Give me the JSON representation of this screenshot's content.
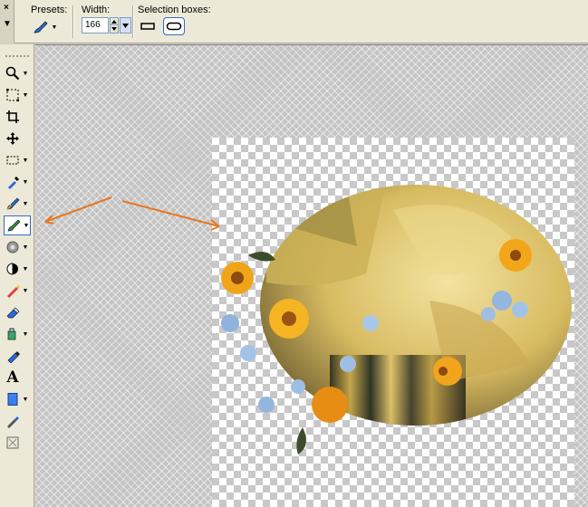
{
  "tool_options": {
    "presets_label": "Presets:",
    "width_label": "Width:",
    "width_value": "166",
    "selection_boxes_label": "Selection boxes:"
  },
  "toolbox": {
    "tools": [
      {
        "name": "zoom-tool",
        "icon": "magnifier-icon"
      },
      {
        "name": "deform-tool",
        "icon": "pick-icon"
      },
      {
        "name": "crop-tool",
        "icon": "crop-icon"
      },
      {
        "name": "move-tool",
        "icon": "move-icon"
      },
      {
        "name": "selection-tool",
        "icon": "selection-icon"
      },
      {
        "name": "dropper-tool",
        "icon": "dropper-icon"
      },
      {
        "name": "paint-brush-tool",
        "icon": "brush-icon"
      },
      {
        "name": "warp-brush-tool",
        "icon": "brush-icon",
        "active": true
      },
      {
        "name": "lighten-darken-tool",
        "icon": "lighten-icon"
      },
      {
        "name": "dodge-tool",
        "icon": "dodge-icon"
      },
      {
        "name": "smudge-tool",
        "icon": "smudge-icon"
      },
      {
        "name": "eraser-tool",
        "icon": "eraser-icon"
      },
      {
        "name": "flood-fill-tool",
        "icon": "bucket-icon"
      },
      {
        "name": "picture-tube-tool",
        "icon": "tube-icon"
      },
      {
        "name": "text-tool",
        "icon": "text-icon",
        "glyph": "A"
      },
      {
        "name": "preset-shape-tool",
        "icon": "rectangle-icon"
      },
      {
        "name": "pen-tool",
        "icon": "pen-icon"
      },
      {
        "name": "object-selector-tool",
        "icon": "object-icon"
      }
    ]
  },
  "colors": {
    "accent": "#316ac5",
    "annotation_arrow": "#e87722"
  }
}
